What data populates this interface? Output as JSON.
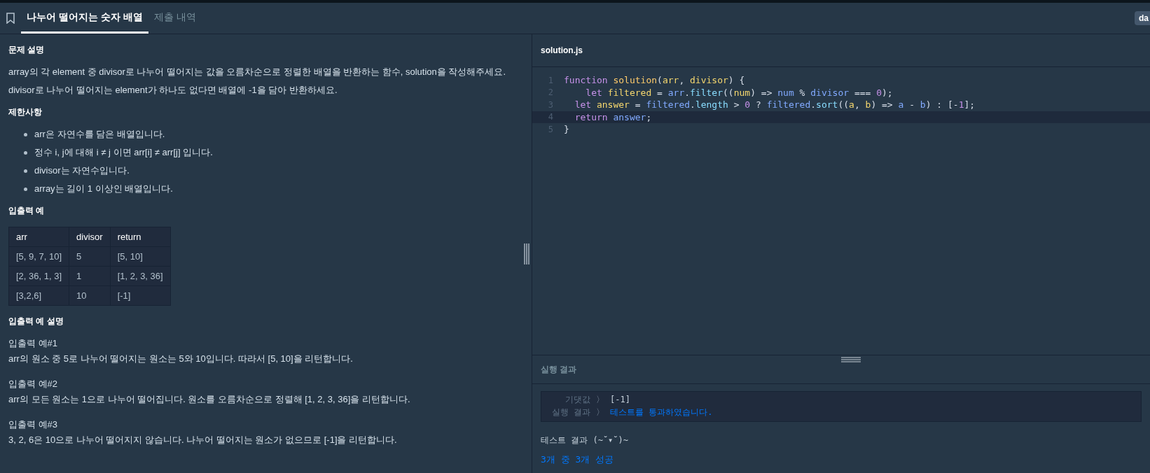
{
  "tabs": [
    {
      "label": "나누어 떨어지는 숫자 배열",
      "selected": true
    },
    {
      "label": "제출 내역",
      "selected": false
    }
  ],
  "user_badge": "da",
  "problem": {
    "description_title": "문제 설명",
    "description": [
      "array의 각 element 중 divisor로 나누어 떨어지는 값을 오름차순으로 정렬한 배열을 반환하는 함수, solution을 작성해주세요.",
      "divisor로 나누어 떨어지는 element가 하나도 없다면 배열에 -1을 담아 반환하세요."
    ],
    "constraints_title": "제한사항",
    "constraints": [
      "arr은 자연수를 담은 배열입니다.",
      "정수 i, j에 대해 i ≠ j 이면 arr[i] ≠ arr[j] 입니다.",
      "divisor는 자연수입니다.",
      "array는 길이 1 이상인 배열입니다."
    ],
    "examples_title": "입출력 예",
    "table": {
      "columns": [
        "arr",
        "divisor",
        "return"
      ],
      "rows": [
        [
          "[5, 9, 7, 10]",
          "5",
          "[5, 10]"
        ],
        [
          "[2, 36, 1, 3]",
          "1",
          "[1, 2, 3, 36]"
        ],
        [
          "[3,2,6]",
          "10",
          "[-1]"
        ]
      ]
    },
    "explanation_title": "입출력 예 설명",
    "explanations": [
      {
        "title": "입출력 예#1",
        "text": "arr의 원소 중 5로 나누어 떨어지는 원소는 5와 10입니다. 따라서 [5, 10]을 리턴합니다."
      },
      {
        "title": "입출력 예#2",
        "text": "arr의 모든 원소는 1으로 나누어 떨어집니다. 원소를 오름차순으로 정렬해 [1, 2, 3, 36]을 리턴합니다."
      },
      {
        "title": "입출력 예#3",
        "text": "3, 2, 6은 10으로 나누어 떨어지지 않습니다. 나누어 떨어지는 원소가 없으므로 [-1]을 리턴합니다."
      }
    ]
  },
  "editor": {
    "filename": "solution.js",
    "lines": [
      {
        "number": "1",
        "selected": false,
        "tokens": [
          {
            "kind": "kw",
            "text": "function "
          },
          {
            "kind": "fn",
            "text": "solution"
          },
          {
            "kind": "plain",
            "text": "("
          },
          {
            "kind": "param",
            "text": "arr"
          },
          {
            "kind": "plain",
            "text": ", "
          },
          {
            "kind": "param",
            "text": "divisor"
          },
          {
            "kind": "plain",
            "text": ") {"
          }
        ]
      },
      {
        "number": "2",
        "selected": false,
        "tokens": [
          {
            "kind": "kw",
            "text": "    let "
          },
          {
            "kind": "param",
            "text": "filtered"
          },
          {
            "kind": "plain",
            "text": " = "
          },
          {
            "kind": "var",
            "text": "arr"
          },
          {
            "kind": "plain",
            "text": "."
          },
          {
            "kind": "prop",
            "text": "filter"
          },
          {
            "kind": "plain",
            "text": "(("
          },
          {
            "kind": "param",
            "text": "num"
          },
          {
            "kind": "plain",
            "text": ") => "
          },
          {
            "kind": "var",
            "text": "num"
          },
          {
            "kind": "plain",
            "text": " % "
          },
          {
            "kind": "var",
            "text": "divisor"
          },
          {
            "kind": "plain",
            "text": " === "
          },
          {
            "kind": "num",
            "text": "0"
          },
          {
            "kind": "plain",
            "text": ");"
          }
        ]
      },
      {
        "number": "3",
        "selected": false,
        "tokens": [
          {
            "kind": "kw",
            "text": "  let "
          },
          {
            "kind": "param",
            "text": "answer"
          },
          {
            "kind": "plain",
            "text": " = "
          },
          {
            "kind": "var",
            "text": "filtered"
          },
          {
            "kind": "plain",
            "text": "."
          },
          {
            "kind": "prop",
            "text": "length"
          },
          {
            "kind": "plain",
            "text": " > "
          },
          {
            "kind": "num",
            "text": "0"
          },
          {
            "kind": "plain",
            "text": " ? "
          },
          {
            "kind": "var",
            "text": "filtered"
          },
          {
            "kind": "plain",
            "text": "."
          },
          {
            "kind": "prop",
            "text": "sort"
          },
          {
            "kind": "plain",
            "text": "(("
          },
          {
            "kind": "param",
            "text": "a"
          },
          {
            "kind": "plain",
            "text": ", "
          },
          {
            "kind": "param",
            "text": "b"
          },
          {
            "kind": "plain",
            "text": ") => "
          },
          {
            "kind": "var",
            "text": "a"
          },
          {
            "kind": "plain",
            "text": " - "
          },
          {
            "kind": "var",
            "text": "b"
          },
          {
            "kind": "plain",
            "text": ") : [-"
          },
          {
            "kind": "num",
            "text": "1"
          },
          {
            "kind": "plain",
            "text": "];"
          }
        ]
      },
      {
        "number": "4",
        "selected": true,
        "tokens": [
          {
            "kind": "kw",
            "text": "  return "
          },
          {
            "kind": "var",
            "text": "answer"
          },
          {
            "kind": "plain",
            "text": ";"
          }
        ]
      },
      {
        "number": "5",
        "selected": false,
        "tokens": [
          {
            "kind": "plain",
            "text": "}"
          }
        ]
      }
    ]
  },
  "results": {
    "title": "실행 결과",
    "rows": [
      {
        "label": "기댓값",
        "separator": "〉",
        "value": "[-1]",
        "kind": "plain"
      },
      {
        "label": "실행 결과",
        "separator": "〉",
        "value": "테스트를 통과하였습니다.",
        "kind": "pass"
      }
    ],
    "summary_title": "테스트 결과 (~˘▾˘)~",
    "summary": "3개 중 3개 성공"
  }
}
